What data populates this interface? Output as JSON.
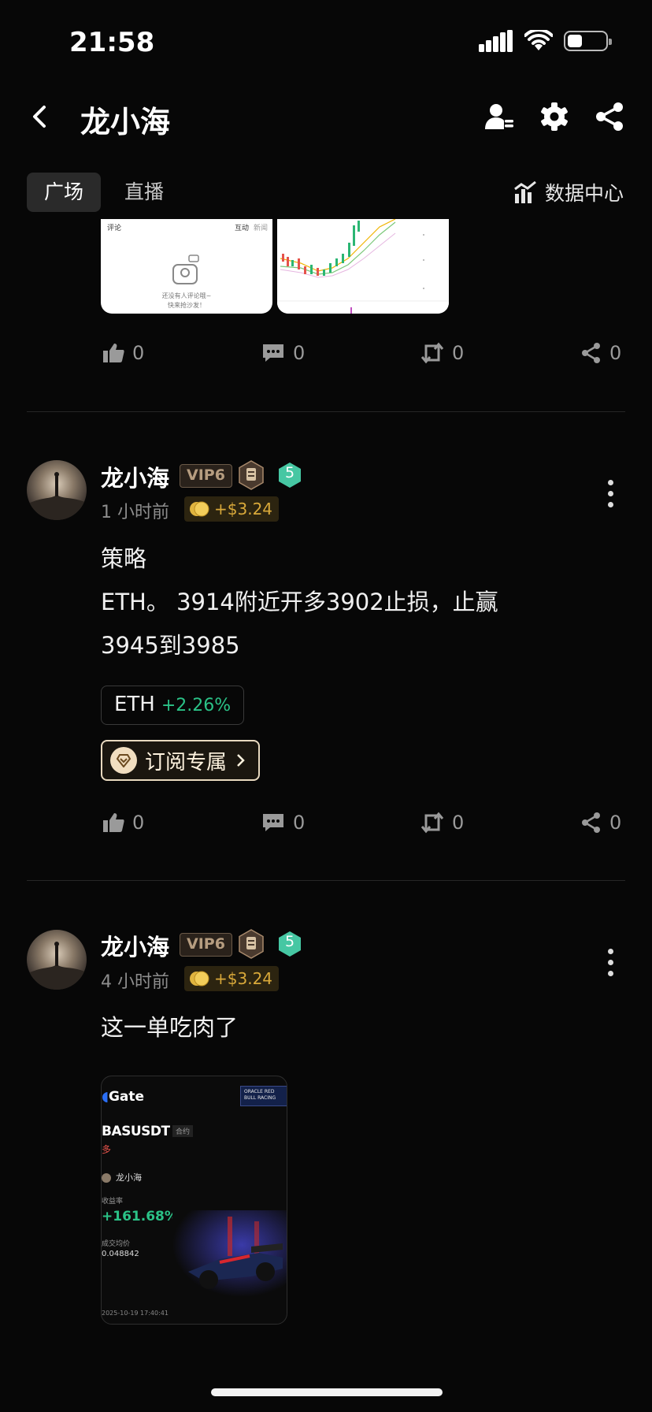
{
  "status_bar": {
    "time": "21:58",
    "battery_level": 0.4
  },
  "header": {
    "title": "龙小海"
  },
  "tabs": [
    {
      "label": "广场",
      "active": true
    },
    {
      "label": "直播",
      "active": false
    }
  ],
  "data_center_label": "数据中心",
  "post0": {
    "thumb1": {
      "left_label": "评论",
      "tab1": "互动",
      "tab2": "新闻",
      "empty_line1": "还没有人评论哦~",
      "empty_line2": "快来抢沙发！"
    },
    "actions": {
      "likes": "0",
      "comments": "0",
      "reposts": "0",
      "shares": "0"
    }
  },
  "post1": {
    "author": "龙小海",
    "vip": "VIP6",
    "level": "5",
    "time": "1 小时前",
    "earn": "+$3.24",
    "text_line1": "策略",
    "text_line2": "ETH。 3914附近开多3902止损，止赢",
    "text_line3": "3945到3985",
    "ticker": {
      "symbol": "ETH",
      "change": "+2.26%"
    },
    "subscribe_label": "订阅专属",
    "actions": {
      "likes": "0",
      "comments": "0",
      "reposts": "0",
      "shares": "0"
    }
  },
  "post2": {
    "author": "龙小海",
    "vip": "VIP6",
    "level": "5",
    "time": "4 小时前",
    "earn": "+$3.24",
    "text_line1": "这一单吃肉了",
    "card": {
      "brand": "Gate",
      "pair": "BASUSDT",
      "type": "合约",
      "side": "多",
      "user": "龙小海",
      "rate_label": "收益率",
      "rate": "+161.68%",
      "price_label": "成交均价",
      "price": "0.048842",
      "timestamp": "2025-10-19 17:40:41",
      "promo": "ORACLE RED BULL RACING"
    }
  },
  "colors": {
    "bg": "#070707",
    "up": "#2bc287",
    "gold": "#d9a93a"
  }
}
